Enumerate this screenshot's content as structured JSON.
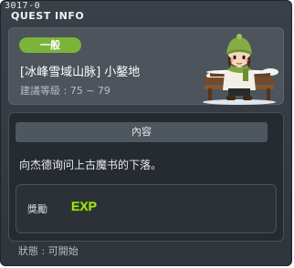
{
  "header": {
    "quest_id": "3017-0",
    "title": "QUEST INFO"
  },
  "quest": {
    "category_badge": "一般",
    "title": "[冰峰雪域山脉] 小鏊地",
    "level": "建議等級 : 75 ~ 79",
    "npc_icon": "npc-girl-on-bench-icon"
  },
  "content": {
    "tab_label": "內容",
    "description": "向杰德询问上古魔书的下落。"
  },
  "reward": {
    "label": "獎勵",
    "icon": "exp-icon",
    "icon_text": "EXP"
  },
  "status": {
    "text": "狀態 : 可開始"
  },
  "colors": {
    "badge": "#7cb43a",
    "window_bg": "#343a41",
    "content_bg": "#262b31",
    "exp_text": "#a8e01e"
  }
}
